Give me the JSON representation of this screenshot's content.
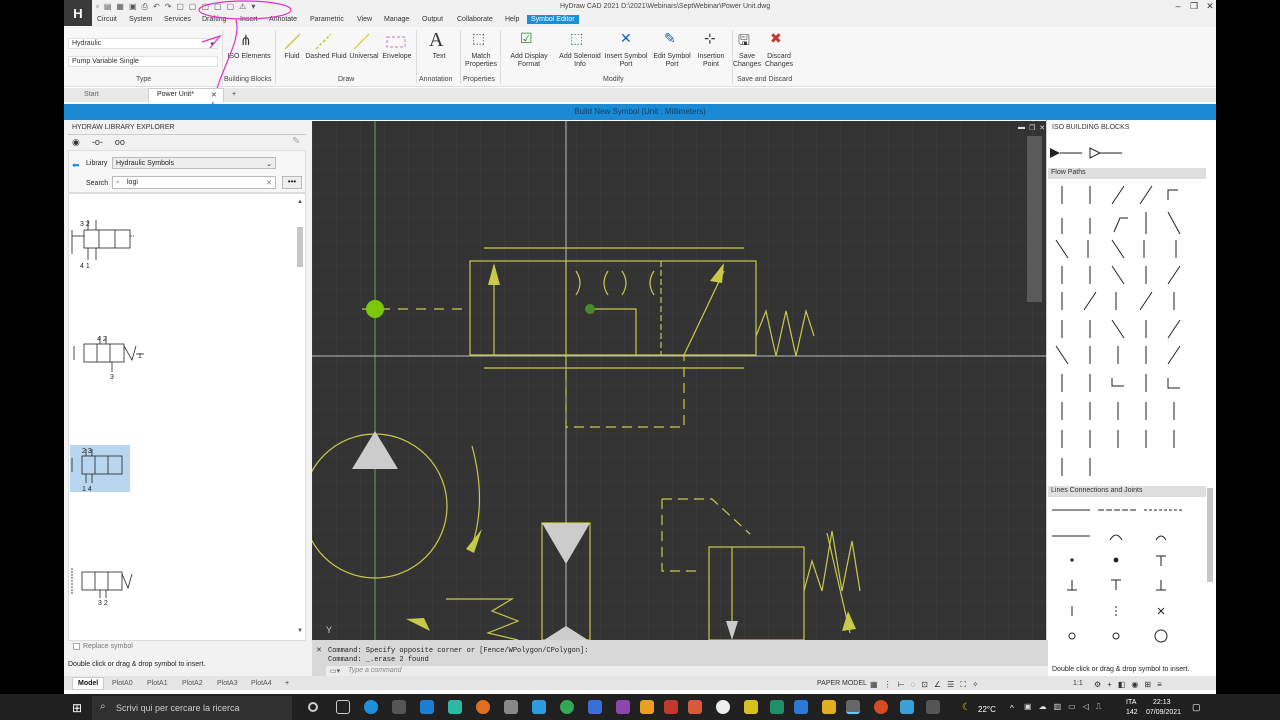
{
  "app": {
    "title": "HyDraw CAD 2021    D:\\2021\\Webinars\\SeptWebinar\\Power Unit.dwg",
    "logo": "H"
  },
  "menu": [
    "Circuit",
    "System",
    "Services",
    "Drafting",
    "Insert",
    "Annotate",
    "Parametric",
    "View",
    "Manage",
    "Output",
    "Collaborate",
    "Help",
    "Symbol Editor"
  ],
  "ribbon": {
    "type_combo1": "Hydraulic",
    "type_combo2": "Pump Variable Single",
    "groups": [
      "Type",
      "Building Blocks",
      "Draw",
      "Annotation",
      "Properties",
      "Modify",
      "Save and Discard"
    ],
    "buttons": {
      "iso_elements": "ISO Elements",
      "fluid": "Fluid",
      "dashed_fluid": "Dashed Fluid",
      "universal": "Universal",
      "envelope": "Envelope",
      "text": "Text",
      "match_properties": "Match Properties",
      "add_display_format": "Add Display Format",
      "add_solenoid_info": "Add Solenoid Info",
      "insert_symbol_port": "Insert Symbol Port",
      "edit_symbol_port": "Edit Symbol Port",
      "insertion_point": "Insertion Point",
      "save_changes": "Save Changes",
      "discard_changes": "Discard Changes"
    }
  },
  "doc_tabs": [
    "Start",
    "Power Unit*"
  ],
  "banner": "Build New Symbol    (Unit : Millimeters)",
  "library": {
    "header": "HYDRAW LIBRARY EXPLORER",
    "library_label": "Library",
    "library_value": "Hydraulic Symbols",
    "search_label": "Search",
    "search_value": "logi",
    "replace_symbol": "Replace symbol",
    "hint": "Double click or drag & drop symbol to insert."
  },
  "right_panel": {
    "header": "ISO BUILDING BLOCKS",
    "section1": "Flow Paths",
    "section2": "Lines Connections and Joints",
    "hint": "Double click or drag & drop symbol to insert."
  },
  "command": {
    "line1": "Command: Specify opposite corner or [Fence/WPolygon/CPolygon]:",
    "line2": "Command: _.erase 2 found",
    "placeholder": "Type a command"
  },
  "layout_tabs": [
    "Model",
    "PlotA0",
    "PlotA1",
    "PlotA2",
    "PlotA3",
    "PlotA4"
  ],
  "status": {
    "paper": "PAPER",
    "model": "MODEL",
    "scale": "1:1"
  },
  "taskbar": {
    "search": "Scrivi qui per cercare la ricerca",
    "temperature": "22°C",
    "lang": "ITA",
    "lang2": "142",
    "time": "22:13",
    "date": "07/09/2021"
  },
  "colors": {
    "accent": "#1a8ad4",
    "symbol": "#c8c84a",
    "green": "#7ac70c"
  }
}
